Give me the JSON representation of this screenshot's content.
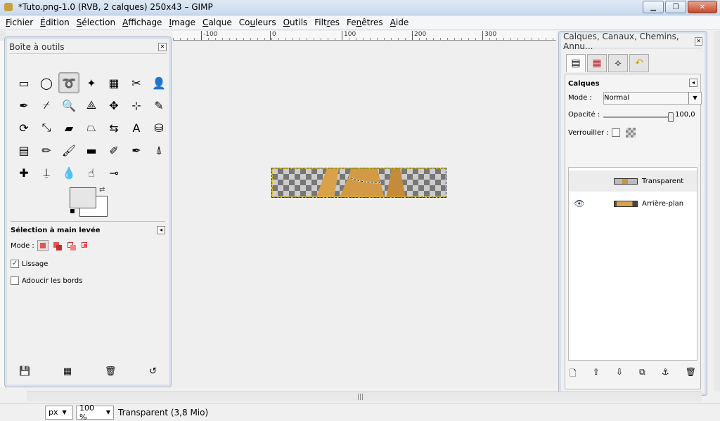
{
  "window": {
    "title": "*Tuto.png-1.0 (RVB, 2 calques) 250x43 – GIMP",
    "minimize": "▁",
    "maximize": "❐",
    "close": "✕"
  },
  "menu": [
    {
      "pre": "",
      "u": "F",
      "post": "ichier"
    },
    {
      "pre": "",
      "u": "É",
      "post": "dition"
    },
    {
      "pre": "",
      "u": "S",
      "post": "élection"
    },
    {
      "pre": "",
      "u": "A",
      "post": "ffichage"
    },
    {
      "pre": "",
      "u": "I",
      "post": "mage"
    },
    {
      "pre": "",
      "u": "C",
      "post": "alque"
    },
    {
      "pre": "Co",
      "u": "u",
      "post": "leurs"
    },
    {
      "pre": "",
      "u": "O",
      "post": "utils"
    },
    {
      "pre": "Filt",
      "u": "r",
      "post": "es"
    },
    {
      "pre": "Fe",
      "u": "n",
      "post": "êtres"
    },
    {
      "pre": "",
      "u": "A",
      "post": "ide"
    }
  ],
  "ruler": {
    "ticks": [
      "-100",
      "0",
      "100",
      "200",
      "300"
    ]
  },
  "toolbox": {
    "title": "Boîte à outils",
    "tools": [
      {
        "name": "rect-select",
        "glyph": "▭"
      },
      {
        "name": "ellipse-select",
        "glyph": "◯"
      },
      {
        "name": "free-select",
        "glyph": "➰"
      },
      {
        "name": "fuzzy-select",
        "glyph": "✦"
      },
      {
        "name": "color-select",
        "glyph": "▦"
      },
      {
        "name": "scissors-select",
        "glyph": "✂"
      },
      {
        "name": "foreground-select",
        "glyph": "👤"
      },
      {
        "name": "paths",
        "glyph": "✒"
      },
      {
        "name": "color-picker",
        "glyph": "⌿"
      },
      {
        "name": "zoom",
        "glyph": "🔍"
      },
      {
        "name": "measure",
        "glyph": "⟁"
      },
      {
        "name": "move",
        "glyph": "✥"
      },
      {
        "name": "align",
        "glyph": "⊹"
      },
      {
        "name": "crop",
        "glyph": "✎"
      },
      {
        "name": "rotate",
        "glyph": "⟳"
      },
      {
        "name": "scale",
        "glyph": "⤡"
      },
      {
        "name": "shear",
        "glyph": "▰"
      },
      {
        "name": "perspective",
        "glyph": "⏢"
      },
      {
        "name": "flip",
        "glyph": "⇆"
      },
      {
        "name": "text",
        "glyph": "A"
      },
      {
        "name": "bucket-fill",
        "glyph": "⛁"
      },
      {
        "name": "blend",
        "glyph": "▤"
      },
      {
        "name": "pencil",
        "glyph": "✏"
      },
      {
        "name": "paintbrush",
        "glyph": "🖌"
      },
      {
        "name": "eraser",
        "glyph": "▬"
      },
      {
        "name": "airbrush",
        "glyph": "✐"
      },
      {
        "name": "ink",
        "glyph": "✒"
      },
      {
        "name": "clone",
        "glyph": "⍋"
      },
      {
        "name": "heal",
        "glyph": "✚"
      },
      {
        "name": "perspective-clone",
        "glyph": "⍊"
      },
      {
        "name": "blur",
        "glyph": "💧"
      },
      {
        "name": "smudge",
        "glyph": "☝"
      },
      {
        "name": "dodge-burn",
        "glyph": "⊸"
      }
    ],
    "selected_index": 2,
    "options": {
      "title": "Sélection à main levée",
      "mode_label": "Mode :",
      "antialias_label": "Lissage",
      "antialias_checked": "✓",
      "feather_label": "Adoucir les bords"
    },
    "footer": [
      {
        "name": "save-options",
        "glyph": "💾"
      },
      {
        "name": "restore-options",
        "glyph": "▦"
      },
      {
        "name": "delete-options",
        "glyph": "🗑"
      },
      {
        "name": "reset-options",
        "glyph": "↺"
      }
    ]
  },
  "layers_panel": {
    "title": "Calques, Canaux, Chemins, Annu...",
    "section_title": "Calques",
    "mode_label": "Mode :",
    "mode_value": "Normal",
    "opacity_label": "Opacité :",
    "opacity_value": "100,0",
    "lock_label": "Verrouiller :",
    "layers": [
      {
        "name": "Transparent",
        "visible": ""
      },
      {
        "name": "Arrière-plan",
        "visible": "👁"
      }
    ],
    "footer": [
      {
        "name": "new-layer",
        "glyph": "🗋"
      },
      {
        "name": "raise-layer",
        "glyph": "⇧"
      },
      {
        "name": "lower-layer",
        "glyph": "⇩"
      },
      {
        "name": "duplicate-layer",
        "glyph": "⧉"
      },
      {
        "name": "anchor-layer",
        "glyph": "⚓"
      },
      {
        "name": "delete-layer",
        "glyph": "🗑"
      }
    ]
  },
  "status": {
    "unit": "px",
    "zoom": "100 %",
    "text": "Transparent (3,8 Mio)"
  },
  "colors": {
    "fg": "#e6e6e6",
    "bg": "#ffffff"
  }
}
